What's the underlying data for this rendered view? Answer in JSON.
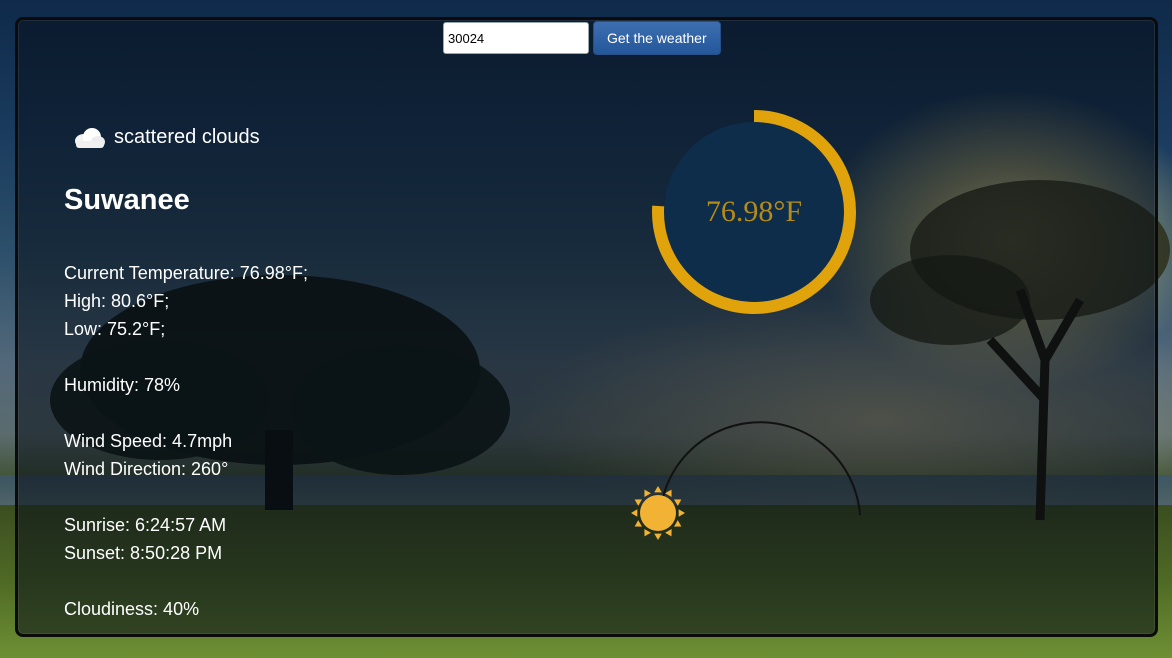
{
  "search": {
    "zip_value": "30024",
    "button_label": "Get the weather"
  },
  "weather": {
    "icon": "cloud-icon",
    "condition": "scattered clouds",
    "city": "Suwanee",
    "current_temperature": "Current Temperature: 76.98°F;",
    "high": "High: 80.6°F;",
    "low": "Low: 75.2°F;",
    "humidity": "Humidity: 78%",
    "wind_speed": "Wind Speed: 4.7mph",
    "wind_direction": "Wind Direction: 260°",
    "sunrise": "Sunrise: 6:24:57 AM",
    "sunset": "Sunset: 8:50:28 PM",
    "cloudiness": "Cloudiness: 40%"
  },
  "gauge": {
    "label": "76.98°F",
    "fraction": 0.76,
    "ring_color": "#e0a30c",
    "fill_color": "#0d2d4a",
    "text_color": "#b58b1a"
  },
  "sun_position": {
    "icon": "sun-icon",
    "fraction_of_day": 0.0,
    "sun_color": "#f2b233"
  }
}
